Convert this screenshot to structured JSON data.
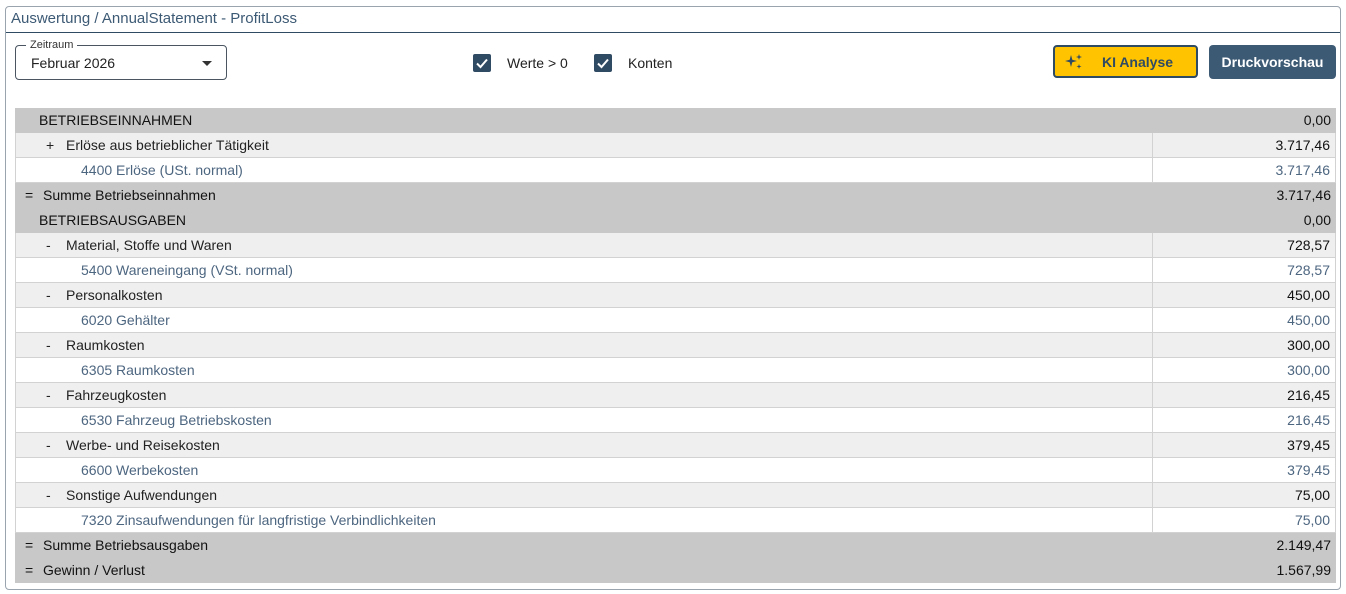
{
  "header": {
    "title": "Auswertung / AnnualStatement - ProfitLoss"
  },
  "toolbar": {
    "period_label": "Zeitraum",
    "period_value": "Februar 2026",
    "check_values_label": "Werte > 0",
    "check_accounts_label": "Konten",
    "ai_button_label": "KI Analyse",
    "print_button_label": "Druckvorschau"
  },
  "colors": {
    "accent": "#2f4a63",
    "ai_button": "#ffc300",
    "print_button": "#3d5a75",
    "section_bg": "#c8c8c8"
  },
  "rows": [
    {
      "type": "section",
      "sign": "",
      "label": "BETRIEBSEINNAHMEN",
      "amount": "0,00"
    },
    {
      "type": "group",
      "sign": "+",
      "label": "Erlöse aus betrieblicher Tätigkeit",
      "amount": "3.717,46"
    },
    {
      "type": "account",
      "sign": "",
      "label": "4400 Erlöse (USt. normal)",
      "amount": "3.717,46"
    },
    {
      "type": "total",
      "sign": "=",
      "label": "Summe Betriebseinnahmen",
      "amount": "3.717,46"
    },
    {
      "type": "section",
      "sign": "",
      "label": "BETRIEBSAUSGABEN",
      "amount": "0,00"
    },
    {
      "type": "group",
      "sign": "-",
      "label": "Material, Stoffe und Waren",
      "amount": "728,57"
    },
    {
      "type": "account",
      "sign": "",
      "label": "5400 Wareneingang (VSt. normal)",
      "amount": "728,57"
    },
    {
      "type": "group",
      "sign": "-",
      "label": "Personalkosten",
      "amount": "450,00"
    },
    {
      "type": "account",
      "sign": "",
      "label": "6020 Gehälter",
      "amount": "450,00"
    },
    {
      "type": "group",
      "sign": "-",
      "label": "Raumkosten",
      "amount": "300,00"
    },
    {
      "type": "account",
      "sign": "",
      "label": "6305 Raumkosten",
      "amount": "300,00"
    },
    {
      "type": "group",
      "sign": "-",
      "label": "Fahrzeugkosten",
      "amount": "216,45"
    },
    {
      "type": "account",
      "sign": "",
      "label": "6530 Fahrzeug Betriebskosten",
      "amount": "216,45"
    },
    {
      "type": "group",
      "sign": "-",
      "label": "Werbe- und Reisekosten",
      "amount": "379,45"
    },
    {
      "type": "account",
      "sign": "",
      "label": "6600 Werbekosten",
      "amount": "379,45"
    },
    {
      "type": "group",
      "sign": "-",
      "label": "Sonstige Aufwendungen",
      "amount": "75,00"
    },
    {
      "type": "account",
      "sign": "",
      "label": "7320 Zinsaufwendungen für langfristige Verbindlichkeiten",
      "amount": "75,00"
    },
    {
      "type": "total",
      "sign": "=",
      "label": "Summe Betriebsausgaben",
      "amount": "2.149,47"
    },
    {
      "type": "total",
      "sign": "=",
      "label": "Gewinn / Verlust",
      "amount": "1.567,99"
    }
  ]
}
